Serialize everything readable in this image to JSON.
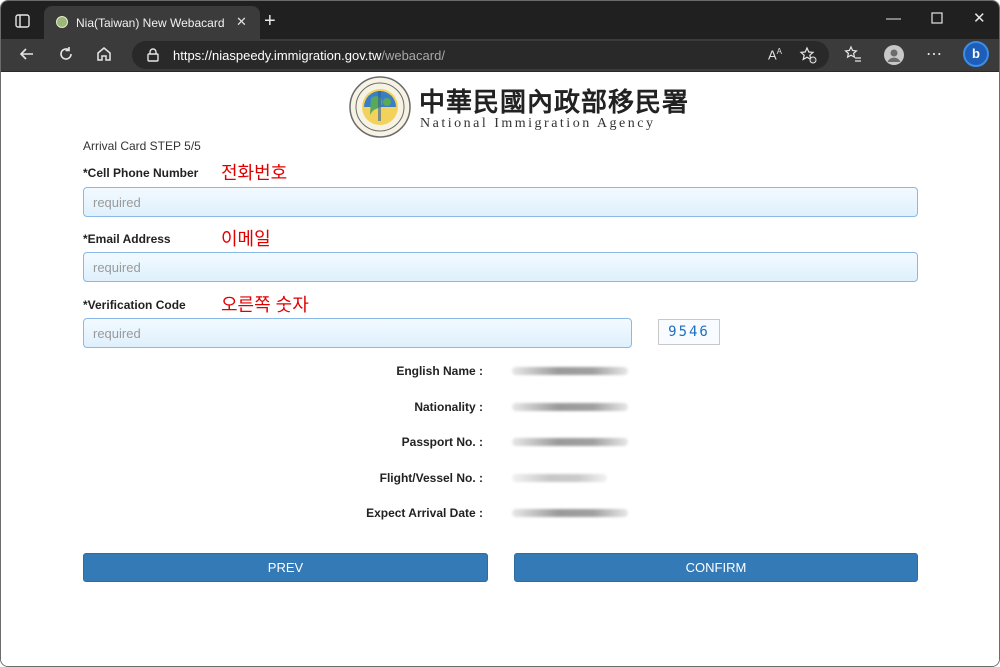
{
  "browser": {
    "tab_title": "Nia(Taiwan) New Webacard",
    "url_host": "https://niaspeedy.immigration.gov.tw",
    "url_path": "/webacard/",
    "bing_label": "b"
  },
  "header": {
    "agency_zh": "中華民國內政部移民署",
    "agency_en": "National Immigration Agency"
  },
  "form": {
    "step": "Arrival Card STEP 5/5",
    "phone": {
      "label": "*Cell Phone Number",
      "note": "전화번호",
      "placeholder": "required",
      "value": ""
    },
    "email": {
      "label": "*Email Address",
      "note": "이메일",
      "placeholder": "required",
      "value": ""
    },
    "verify": {
      "label": "*Verification Code",
      "note": "오른쪽 숫자",
      "placeholder": "required",
      "value": ""
    },
    "captcha": "9546"
  },
  "summary": [
    {
      "label": "English Name :"
    },
    {
      "label": "Nationality :"
    },
    {
      "label": "Passport No. :"
    },
    {
      "label": "Flight/Vessel No. :"
    },
    {
      "label": "Expect Arrival Date :"
    }
  ],
  "buttons": {
    "prev": "PREV",
    "confirm": "CONFIRM"
  },
  "colors": {
    "primary_button": "#337ab7",
    "annotation": "#e00000",
    "input_border": "#8ab8e8"
  },
  "icons": [
    "tab-actions-icon",
    "favicon-icon",
    "close-icon",
    "plus-icon",
    "minimize-icon",
    "maximize-icon",
    "back-icon",
    "refresh-icon",
    "home-icon",
    "lock-icon",
    "read-aloud-icon",
    "favorite-add-icon",
    "favorites-icon",
    "profile-icon",
    "more-icon",
    "bing-icon"
  ]
}
